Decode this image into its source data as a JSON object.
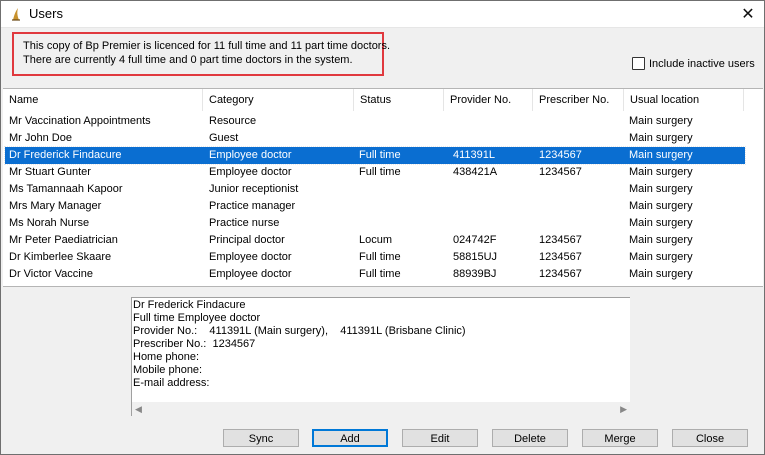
{
  "window": {
    "title": "Users",
    "icon": "bp-premier-app-icon",
    "close_glyph": "✕"
  },
  "licence": {
    "line1": "This copy of Bp Premier is licenced for 11 full time and 11 part time doctors.",
    "line2": "There are currently 4 full time and 0 part time doctors in the system."
  },
  "include_inactive": {
    "label": "Include inactive users",
    "checked": false
  },
  "table": {
    "columns": [
      "Name",
      "Category",
      "Status",
      "Provider No.",
      "Prescriber No.",
      "Usual location"
    ],
    "rows": [
      {
        "name": "Mr Vaccination Appointments",
        "category": "Resource",
        "status": "",
        "provider": "",
        "prescriber": "",
        "location": "Main surgery"
      },
      {
        "name": "Mr John Doe",
        "category": "Guest",
        "status": "",
        "provider": "",
        "prescriber": "",
        "location": "Main surgery"
      },
      {
        "name": "Dr Frederick Findacure",
        "category": "Employee doctor",
        "status": "Full time",
        "provider": "411391L",
        "prescriber": "1234567",
        "location": "Main surgery"
      },
      {
        "name": "Mr Stuart Gunter",
        "category": "Employee doctor",
        "status": "Full time",
        "provider": "438421A",
        "prescriber": "1234567",
        "location": "Main surgery"
      },
      {
        "name": "Ms Tamannaah Kapoor",
        "category": "Junior receptionist",
        "status": "",
        "provider": "",
        "prescriber": "",
        "location": "Main surgery"
      },
      {
        "name": "Mrs Mary Manager",
        "category": "Practice manager",
        "status": "",
        "provider": "",
        "prescriber": "",
        "location": "Main surgery"
      },
      {
        "name": "Ms Norah Nurse",
        "category": "Practice nurse",
        "status": "",
        "provider": "",
        "prescriber": "",
        "location": "Main surgery"
      },
      {
        "name": "Mr Peter Paediatrician",
        "category": "Principal doctor",
        "status": "Locum",
        "provider": "024742F",
        "prescriber": "1234567",
        "location": "Main surgery"
      },
      {
        "name": "Dr Kimberlee Skaare",
        "category": "Employee doctor",
        "status": "Full time",
        "provider": "58815UJ",
        "prescriber": "1234567",
        "location": "Main surgery"
      },
      {
        "name": "Dr Victor Vaccine",
        "category": "Employee doctor",
        "status": "Full time",
        "provider": "88939BJ",
        "prescriber": "1234567",
        "location": "Main surgery"
      }
    ],
    "selected_index": 2
  },
  "details": {
    "lines": [
      "Dr Frederick Findacure",
      "Full time Employee doctor",
      "Provider No.:    411391L (Main surgery),    411391L (Brisbane Clinic)",
      "Prescriber No.:  1234567",
      "Home phone:",
      "Mobile phone:",
      "E-mail address:"
    ]
  },
  "buttons": {
    "sync": "Sync",
    "add": "Add",
    "edit": "Edit",
    "delete": "Delete",
    "merge": "Merge",
    "close": "Close"
  },
  "colors": {
    "selection": "#0a6ed1",
    "licence_border": "#e0393e",
    "default_button_border": "#0078d7"
  }
}
